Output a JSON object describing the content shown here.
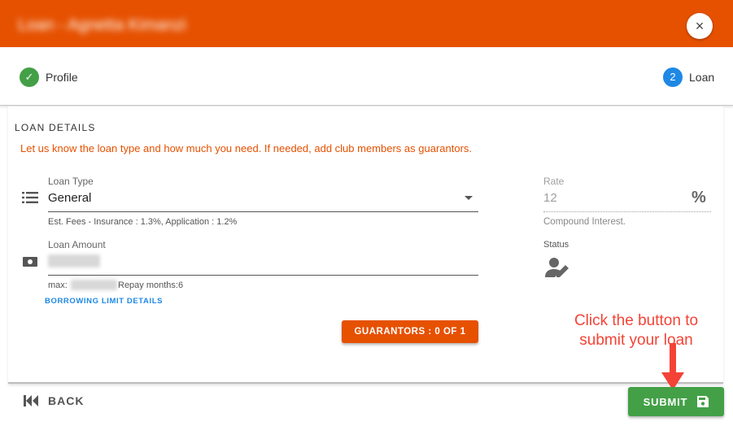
{
  "header": {
    "title": "Loan - Agnetta Kimanzi",
    "close_label": "×"
  },
  "stepper": {
    "steps": [
      {
        "label": "Profile",
        "marker": "✓",
        "state": "done"
      },
      {
        "label": "Loan",
        "marker": "2",
        "state": "active"
      }
    ]
  },
  "section": {
    "title": "LOAN DETAILS",
    "description": "Let us know the loan type and how much you need. If needed, add club members as guarantors."
  },
  "loan_type": {
    "label": "Loan Type",
    "value": "General",
    "icon": "list-icon",
    "hint": "Est. Fees - Insurance : 1.3%, Application : 1.2%"
  },
  "loan_amount": {
    "label": "Loan Amount",
    "icon": "money-icon",
    "max_prefix": "max:",
    "repay": "Repay months:6",
    "limit_link": "BORROWING LIMIT DETAILS"
  },
  "guarantors_button": "GUARANTORS : 0 OF 1",
  "rate": {
    "label": "Rate",
    "value": "12",
    "icon": "percent-icon",
    "note": "Compound Interest."
  },
  "status": {
    "label": "Status",
    "icon": "person-edit-icon"
  },
  "footer": {
    "back_label": "BACK",
    "submit_label": "SUBMIT"
  },
  "annotation": {
    "line1": "Click the button to",
    "line2": "submit your loan"
  },
  "colors": {
    "header": "#e65100",
    "accent": "#e65100",
    "success": "#43a047",
    "link": "#1e88e5",
    "annotation": "#f44336"
  }
}
